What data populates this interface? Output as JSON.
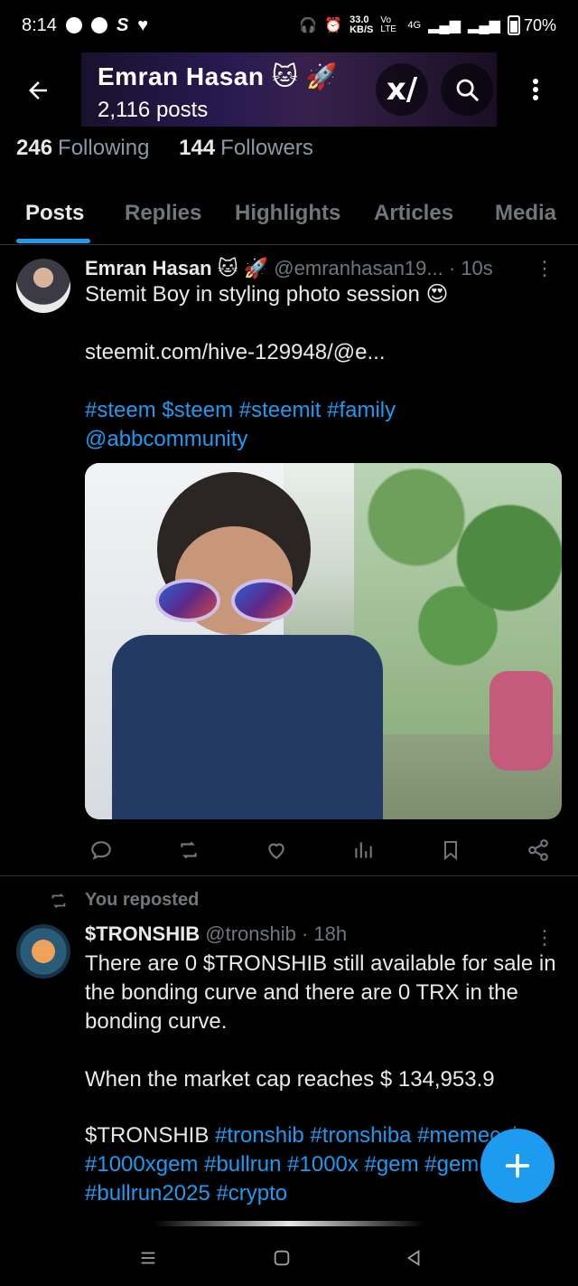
{
  "status": {
    "time": "8:14",
    "speed_value": "33.0",
    "speed_unit": "KB/S",
    "volte": "Vo LTE",
    "network": "4G",
    "battery": "70%"
  },
  "header": {
    "name": "Emran Hasan 🐱 🚀",
    "posts": "2,116 posts"
  },
  "follow": {
    "following_count": "246",
    "following_label": "Following",
    "followers_count": "144",
    "followers_label": "Followers"
  },
  "tabs": [
    "Posts",
    "Replies",
    "Highlights",
    "Articles",
    "Media"
  ],
  "post1": {
    "name": "Emran Hasan 🐱 🚀",
    "handle": "@emranhasan19...",
    "time": "· 10s",
    "text": "Stemit Boy in styling photo session 😍",
    "link": "steemit.com/hive-129948/@e...",
    "tags": "#steem $steem #steemit #family",
    "mention": "@abbcommunity"
  },
  "repost_label": "You reposted",
  "post2": {
    "name": "$TRONSHIB",
    "handle": "@tronshib",
    "time": "· 18h",
    "line1": "There are 0 $TRONSHIB still available for sale in",
    "line2": "the bonding curve and there are 0 TRX in the",
    "line3": "bonding curve.",
    "line4": "When the market cap reaches $ 134,953.9",
    "line5_prefix": "$TRONSHIB",
    "line5_tags": "#tronshib #tronshiba #memecoin",
    "line6": "#1000xgem #bullrun #1000x #gem #gem",
    "line7": "#bullrun2025 #crypto"
  }
}
